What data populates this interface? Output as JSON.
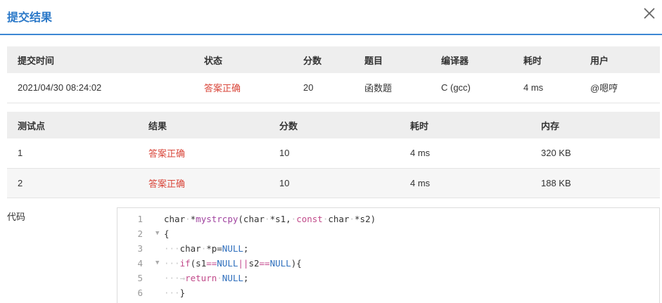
{
  "dialog": {
    "title": "提交结果"
  },
  "summary": {
    "headers": [
      "提交时间",
      "状态",
      "分数",
      "题目",
      "编译器",
      "耗时",
      "用户"
    ],
    "row": {
      "time": "2021/04/30 08:24:02",
      "status": "答案正确",
      "score": "20",
      "problem": "函数题",
      "compiler": "C (gcc)",
      "duration": "4 ms",
      "user": "@嗯哼"
    }
  },
  "cases": {
    "headers": [
      "测试点",
      "结果",
      "分数",
      "耗时",
      "内存"
    ],
    "rows": [
      {
        "id": "1",
        "result": "答案正确",
        "score": "10",
        "time": "4 ms",
        "memory": "320 KB"
      },
      {
        "id": "2",
        "result": "答案正确",
        "score": "10",
        "time": "4 ms",
        "memory": "188 KB"
      }
    ]
  },
  "code": {
    "label": "代码",
    "line_numbers": [
      "1",
      "2",
      "3",
      "4",
      "5",
      "6"
    ]
  },
  "colors": {
    "accent": "#2a78c8",
    "success": "#d9463a",
    "header_bg": "#eeeeee"
  },
  "icons": {
    "close": "close-icon",
    "fold": "fold-arrow-icon"
  }
}
